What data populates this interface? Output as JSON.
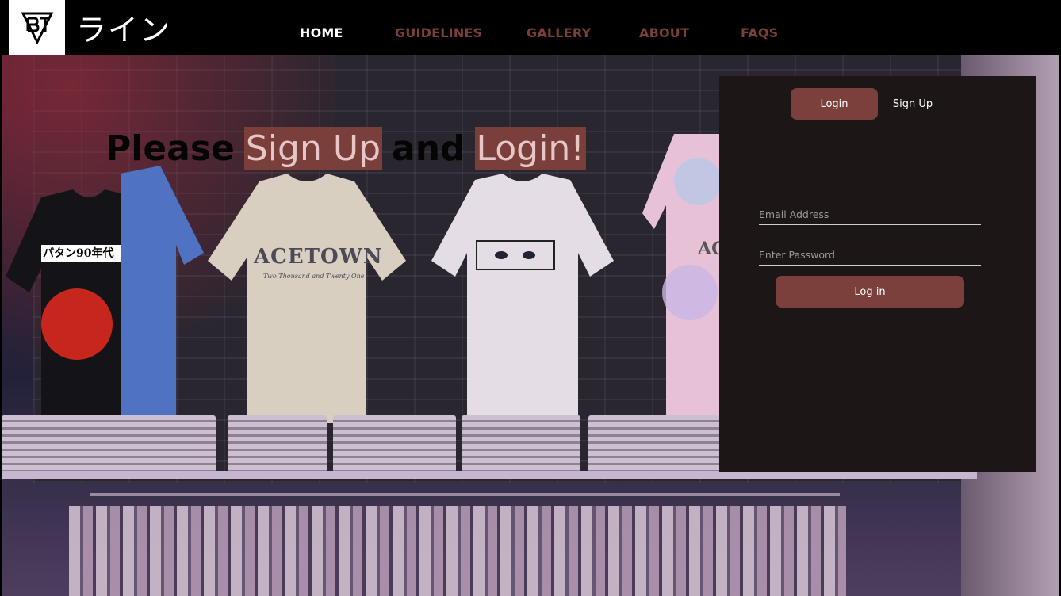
{
  "brand": {
    "name": "ライン",
    "logo_icon": "btc-shield-logo-icon"
  },
  "nav": {
    "items": [
      {
        "label": "HOME",
        "active": true
      },
      {
        "label": "GUIDELINES",
        "active": false
      },
      {
        "label": "GALLERY",
        "active": false
      },
      {
        "label": "ABOUT",
        "active": false
      },
      {
        "label": "FAQS",
        "active": false
      }
    ]
  },
  "hero": {
    "headline": {
      "w1": "Please",
      "w2": "Sign Up",
      "w3": "and",
      "w4": "Login!"
    },
    "shirt_prints": {
      "tee1": "パタン90年代",
      "tee2_line1": "ACETOWN",
      "tee2_line2": "Two Thousand and Twenty One",
      "tee4": "ACE"
    }
  },
  "auth": {
    "tabs": {
      "login": "Login",
      "signup": "Sign Up"
    },
    "email_placeholder": "Email Address",
    "password_placeholder": "Enter Password",
    "submit_label": "Log in"
  },
  "colors": {
    "accent": "#7b403b",
    "nav_inactive": "#7a3f38",
    "panel_bg": "#1c1616",
    "navbar_bg": "#000000"
  }
}
